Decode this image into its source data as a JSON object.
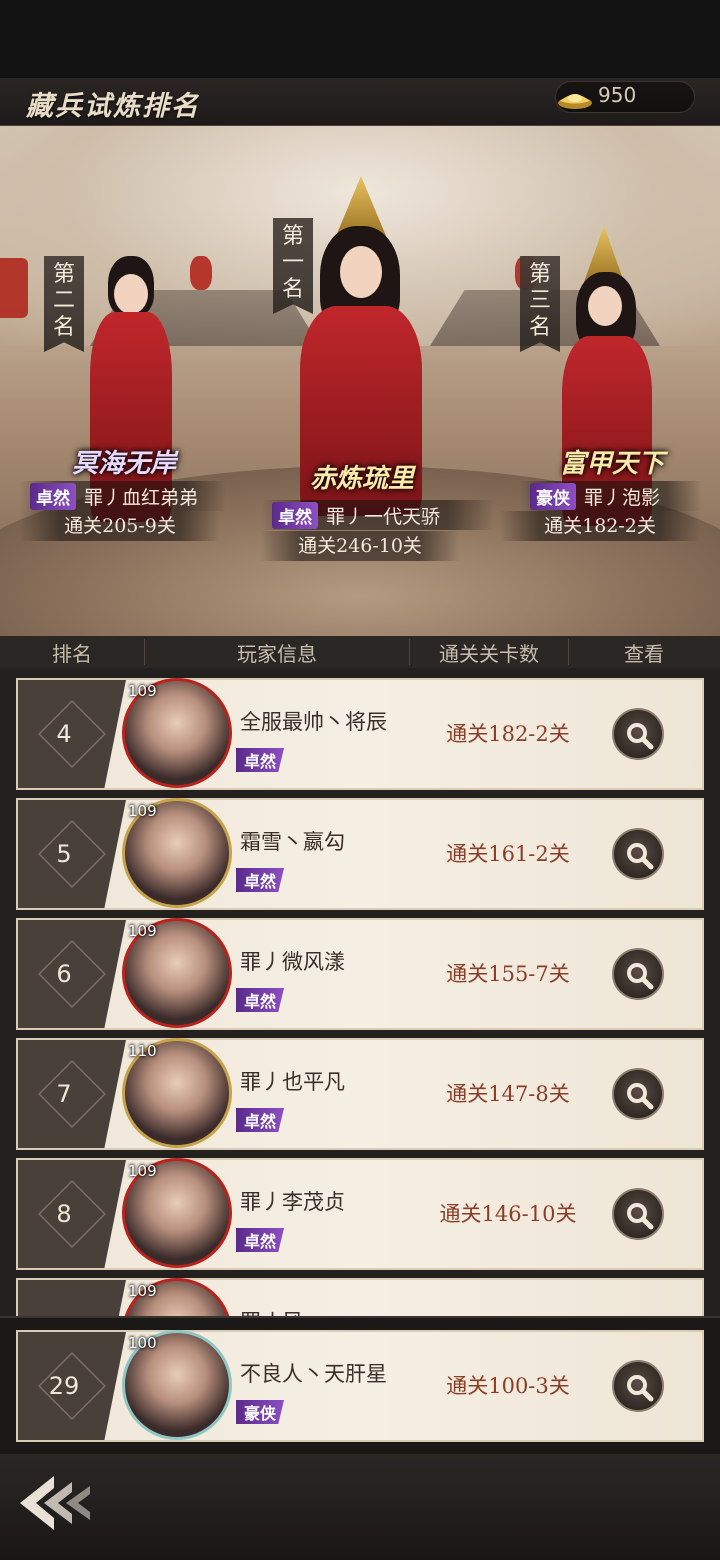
{
  "header": {
    "title": "藏兵试炼排名",
    "currency": {
      "icon": "gold-ingot-icon",
      "amount": "950"
    }
  },
  "podium": [
    {
      "rank_label": "第一名",
      "guild_logo": "赤炼琉里",
      "badge": "卓然",
      "name": "罪丿一代天骄",
      "progress": "通关246-10关"
    },
    {
      "rank_label": "第二名",
      "guild_logo": "冥海无岸",
      "badge": "卓然",
      "name": "罪丿血红弟弟",
      "progress": "通关205-9关"
    },
    {
      "rank_label": "第三名",
      "guild_logo": "富甲天下",
      "badge": "豪侠",
      "name": "罪丿泡影",
      "progress": "通关182-2关"
    }
  ],
  "columns": [
    "排名",
    "玩家信息",
    "通关关卡数",
    "查看"
  ],
  "rows": [
    {
      "rank": "4",
      "level": "109",
      "name": "全服最帅丶将辰",
      "badge": "卓然",
      "progress": "通关182-2关"
    },
    {
      "rank": "5",
      "level": "109",
      "name": "霜雪丶嬴勾",
      "badge": "卓然",
      "progress": "通关161-2关"
    },
    {
      "rank": "6",
      "level": "109",
      "name": "罪丿微风漾",
      "badge": "卓然",
      "progress": "通关155-7关"
    },
    {
      "rank": "7",
      "level": "110",
      "name": "罪丿也平凡",
      "badge": "卓然",
      "progress": "通关147-8关"
    },
    {
      "rank": "8",
      "level": "109",
      "name": "罪丿李茂贞",
      "badge": "卓然",
      "progress": "通关146-10关"
    },
    {
      "rank": "",
      "level": "109",
      "name": "罪丿风",
      "badge": "",
      "progress": ""
    }
  ],
  "self": {
    "rank": "29",
    "level": "100",
    "name": "不良人丶天肝星",
    "badge": "豪侠",
    "progress": "通关100-3关"
  },
  "nav": {
    "back_icon": "back-arrow-icon"
  }
}
